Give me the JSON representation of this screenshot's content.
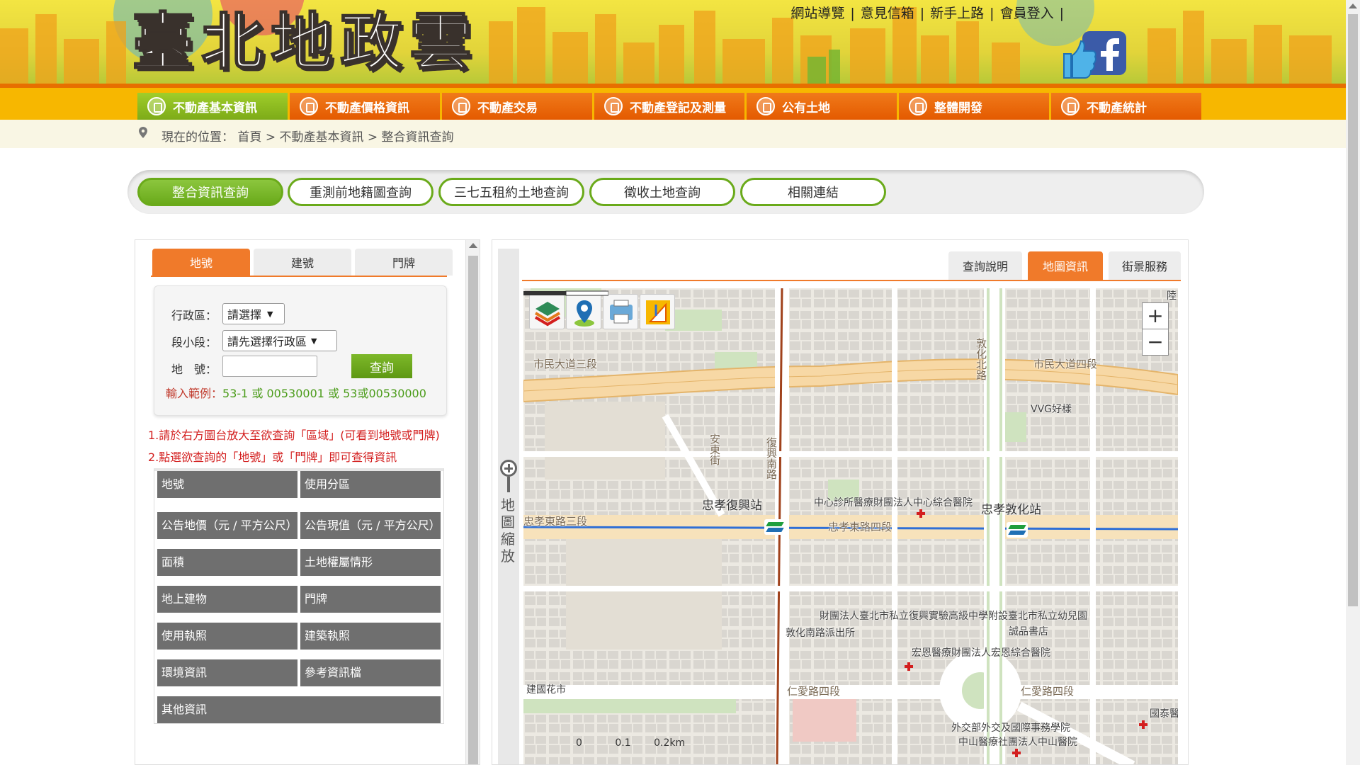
{
  "site": {
    "title": "臺北地政雲",
    "top_links": [
      "網站導覽",
      "意見信箱",
      "新手上路",
      "會員登入"
    ],
    "separator": "|"
  },
  "nav": {
    "items": [
      {
        "label": "不動產基本資訊",
        "active": true
      },
      {
        "label": "不動產價格資訊",
        "active": false
      },
      {
        "label": "不動產交易",
        "active": false
      },
      {
        "label": "不動產登記及測量",
        "active": false
      },
      {
        "label": "公有土地",
        "active": false
      },
      {
        "label": "整體開發",
        "active": false
      },
      {
        "label": "不動產統計",
        "active": false
      }
    ]
  },
  "breadcrumb": {
    "prefix": "現在的位置：",
    "items": [
      "首頁",
      "不動產基本資訊",
      "整合資訊查詢"
    ],
    "separator": ">"
  },
  "subtabs": {
    "items": [
      {
        "label": "整合資訊查詢",
        "active": true
      },
      {
        "label": "重測前地籍圖查詢",
        "active": false
      },
      {
        "label": "三七五租約土地查詢",
        "active": false
      },
      {
        "label": "徵收土地查詢",
        "active": false
      },
      {
        "label": "相關連結",
        "active": false
      }
    ]
  },
  "query": {
    "tabs": [
      {
        "label": "地號",
        "active": true
      },
      {
        "label": "建號",
        "active": false
      },
      {
        "label": "門牌",
        "active": false
      }
    ],
    "district_label": "行政區：",
    "district_value": "請選擇",
    "section_label": "段小段：",
    "section_value": "請先選擇行政區",
    "lot_label": "地　號：",
    "lot_value": "",
    "search_label": "查詢",
    "example_prefix": "輸入範例：",
    "example_value": "53-1 或 00530001 或 53或00530000"
  },
  "instructions": [
    "1.請於右方圖台放大至欲查詢「區域」(可看到地號或門牌)",
    "2.點選欲查詢的「地號」或「門牌」即可查得資訊"
  ],
  "info_table": {
    "rows": [
      [
        "地號",
        "使用分區"
      ],
      [
        "公告地價（元 / 平方公尺）",
        "公告現值（元 / 平方公尺）"
      ],
      [
        "面積",
        "土地權屬情形"
      ],
      [
        "地上建物",
        "門牌"
      ],
      [
        "使用執照",
        "建築執照"
      ],
      [
        "環境資訊",
        "參考資訊檔"
      ],
      [
        "其他資訊",
        ""
      ]
    ]
  },
  "map_panel": {
    "tabs": [
      {
        "label": "查詢說明",
        "active": false
      },
      {
        "label": "地圖資訊",
        "active": true
      },
      {
        "label": "街景服務",
        "active": false
      }
    ],
    "zoom_label": "地圖縮放",
    "tools": [
      "layers-icon",
      "location-pin-icon",
      "print-icon",
      "measure-icon"
    ],
    "zoom_in": "+",
    "zoom_out": "−",
    "labels": {
      "road_civic_3": "市民大道三段",
      "road_civic_4": "市民大道四段",
      "road_zhongxiao_3": "忠孝東路三段",
      "road_zhongxiao_4": "忠孝東路四段",
      "road_renai_4a": "仁愛路四段",
      "road_renai_4b": "仁愛路四段",
      "road_fuxing": "復興南路",
      "road_dunhua": "敦化北路",
      "road_anton": "安東街",
      "vvg": "VVG好樣",
      "station_fuxing": "忠孝復興站",
      "station_dunhua": "忠孝敦化站",
      "clinic": "中心診所醫療財團法人中心綜合醫院",
      "school": "財團法人臺北市私立復興實驗高級中學附設臺北市私立幼兒園",
      "eslite": "誠品書店",
      "police": "敦化南路派出所",
      "hongen": "宏恩醫療財團法人宏恩綜合醫院",
      "flower": "建國花市",
      "mofa": "外交部外交及國際事務學院",
      "zhongshan": "中山醫療社團法人中山醫院",
      "guotai": "國泰醫",
      "edge": "陸"
    },
    "scale": [
      "0",
      "0.1",
      "0.2km"
    ]
  },
  "colors": {
    "nav_orange": "#e45a00",
    "nav_active_green": "#7dab18",
    "tab_orange": "#f07a2a",
    "accent_green": "#6aaa1a",
    "instruction_red": "#d31f1f",
    "table_gray": "#6f6f6f"
  }
}
